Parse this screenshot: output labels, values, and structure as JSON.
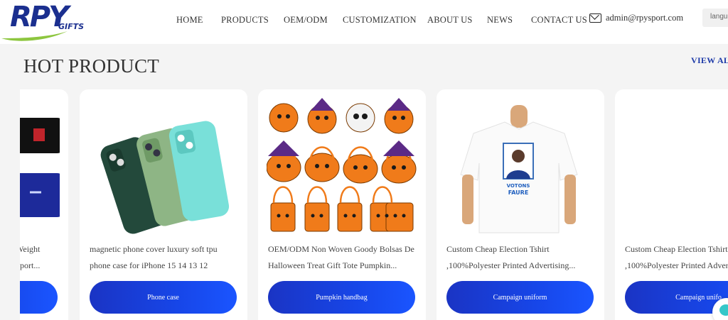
{
  "header": {
    "logo_text": "RPY",
    "logo_sub": "GIFTS",
    "nav": [
      {
        "label": "HOME"
      },
      {
        "label": "PRODUCTS"
      },
      {
        "label": "OEM/ODM"
      },
      {
        "label": "CUSTOMIZATION"
      },
      {
        "label": "ABOUT US"
      },
      {
        "label": "NEWS"
      },
      {
        "label": "CONTACT US"
      }
    ],
    "email": "admin@rpysport.com",
    "language_label": "langu"
  },
  "section": {
    "title": "HOT PRODUCT",
    "view_all": "VIEW ALL"
  },
  "products": [
    {
      "title_line1": "Weight",
      "title_line2": "pport...",
      "button": ""
    },
    {
      "title_line1": "magnetic phone cover luxury soft tpu",
      "title_line2": "phone case for iPhone 15 14 13 12",
      "button": "Phone case"
    },
    {
      "title_line1": "OEM/ODM Non Woven Goody Bolsas De",
      "title_line2": "Halloween Treat Gift Tote Pumpkin...",
      "button": "Pumpkin handbag"
    },
    {
      "title_line1": "Custom Cheap Election Tshirt",
      "title_line2": ",100%Polyester Printed Advertising...",
      "button": "Campaign uniform"
    },
    {
      "title_line1": "Custom Cheap Election Tshirt",
      "title_line2": ",100%Polyester Printed Advert",
      "button": "Campaign unifo"
    }
  ],
  "tshirt_print": {
    "line1": "VOTONS",
    "line2": "FAURE"
  },
  "colors": {
    "brand_blue": "#1b2f8f",
    "accent_green": "#8dc63f",
    "button_blue": "#1746e8",
    "view_all_blue": "#1d3aa8"
  }
}
